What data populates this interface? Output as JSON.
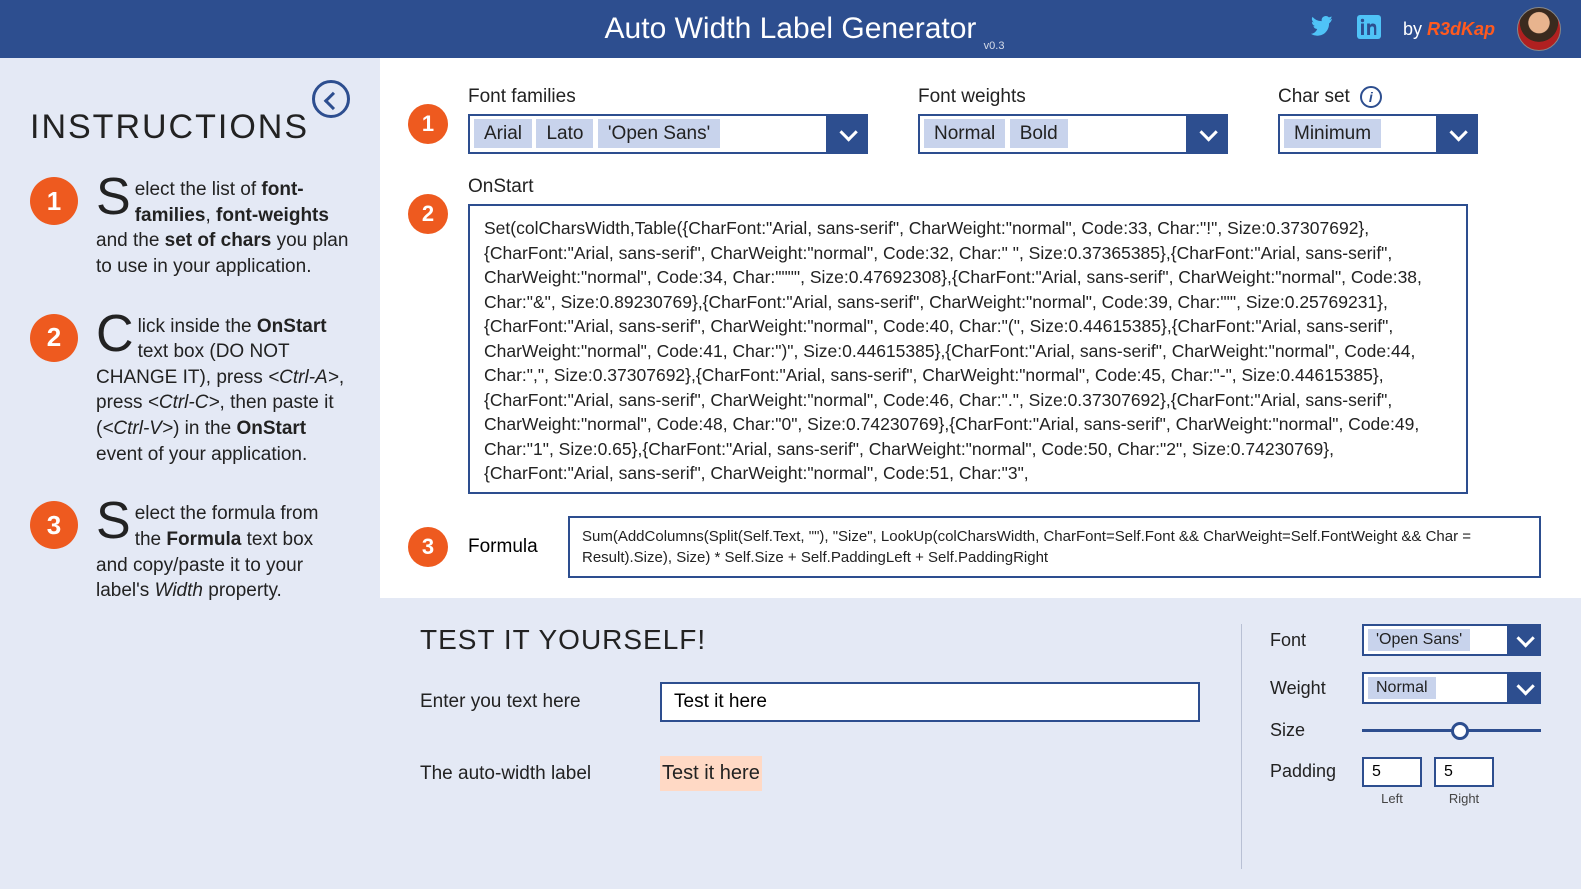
{
  "header": {
    "title": "Auto Width Label Generator",
    "version": "v0.3",
    "by_prefix": "by ",
    "author": "R3dKap"
  },
  "sidebar": {
    "heading": "INSTRUCTIONS",
    "items": [
      {
        "num": "1",
        "dropcap": "S",
        "html": "elect the list of <b>font-families</b>, <b>font-weights</b> and the <b>set of chars</b> you plan to use in your application."
      },
      {
        "num": "2",
        "dropcap": "C",
        "html": "lick inside the <b>OnStart</b> text box (DO NOT CHANGE IT), press <i>&lt;Ctrl-A&gt;</i>, press <i>&lt;Ctrl-C&gt;</i>, then paste it (<i>&lt;Ctrl-V&gt;</i>) in the <b>OnStart</b> event of your application."
      },
      {
        "num": "3",
        "dropcap": "S",
        "html": "elect the formula from the <b>Formula</b> text box and copy/paste it to your label's <i>Width</i> property."
      }
    ]
  },
  "config": {
    "fontfam": {
      "label": "Font families",
      "tags": [
        "Arial",
        "Lato",
        "'Open Sans'"
      ]
    },
    "fontweight": {
      "label": "Font weights",
      "tags": [
        "Normal",
        "Bold"
      ]
    },
    "charset": {
      "label": "Char set",
      "tags": [
        "Minimum"
      ]
    },
    "onstart": {
      "label": "OnStart",
      "value": "Set(colCharsWidth,Table({CharFont:\"Arial, sans-serif\", CharWeight:\"normal\", Code:33, Char:\"!\", Size:0.37307692},{CharFont:\"Arial, sans-serif\", CharWeight:\"normal\", Code:32, Char:\" \", Size:0.37365385},{CharFont:\"Arial, sans-serif\", CharWeight:\"normal\", Code:34, Char:\"\"\"\", Size:0.47692308},{CharFont:\"Arial, sans-serif\", CharWeight:\"normal\", Code:38, Char:\"&\", Size:0.89230769},{CharFont:\"Arial, sans-serif\", CharWeight:\"normal\", Code:39, Char:\"'\", Size:0.25769231},{CharFont:\"Arial, sans-serif\", CharWeight:\"normal\", Code:40, Char:\"(\", Size:0.44615385},{CharFont:\"Arial, sans-serif\", CharWeight:\"normal\", Code:41, Char:\")\", Size:0.44615385},{CharFont:\"Arial, sans-serif\", CharWeight:\"normal\", Code:44, Char:\",\", Size:0.37307692},{CharFont:\"Arial, sans-serif\", CharWeight:\"normal\", Code:45, Char:\"-\", Size:0.44615385},{CharFont:\"Arial, sans-serif\", CharWeight:\"normal\", Code:46, Char:\".\", Size:0.37307692},{CharFont:\"Arial, sans-serif\", CharWeight:\"normal\", Code:48, Char:\"0\", Size:0.74230769},{CharFont:\"Arial, sans-serif\", CharWeight:\"normal\", Code:49, Char:\"1\", Size:0.65},{CharFont:\"Arial, sans-serif\", CharWeight:\"normal\", Code:50, Char:\"2\", Size:0.74230769},{CharFont:\"Arial, sans-serif\", CharWeight:\"normal\", Code:51, Char:\"3\","
    },
    "formula": {
      "label": "Formula",
      "value": "Sum(AddColumns(Split(Self.Text, \"\"), \"Size\", LookUp(colCharsWidth, CharFont=Self.Font && CharWeight=Self.FontWeight && Char = Result).Size), Size) * Self.Size + Self.PaddingLeft + Self.PaddingRight"
    }
  },
  "test": {
    "heading": "TEST IT YOURSELF!",
    "enter_label": "Enter you text here",
    "enter_value": "Test it here",
    "autowidth_label": "The auto-width label",
    "autowidth_value": "Test it here",
    "controls": {
      "font": {
        "label": "Font",
        "value": "'Open Sans'"
      },
      "weight": {
        "label": "Weight",
        "value": "Normal"
      },
      "size": {
        "label": "Size"
      },
      "padding": {
        "label": "Padding",
        "left": "5",
        "right": "5",
        "left_sub": "Left",
        "right_sub": "Right"
      }
    }
  }
}
